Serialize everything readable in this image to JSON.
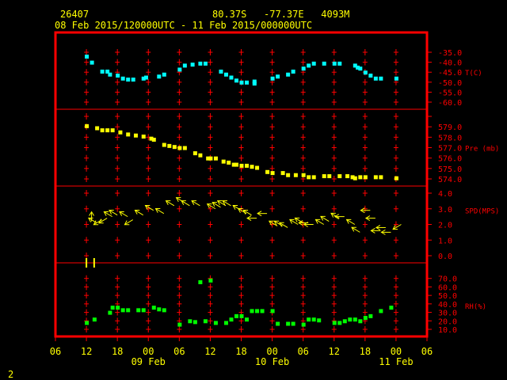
{
  "header": {
    "station": "26407",
    "location": "80.37S   -77.37E   4093M",
    "period": "08 Feb 2015/120000UTC - 11 Feb 2015/000000UTC"
  },
  "footer": {
    "page": "2"
  },
  "colors": {
    "frame": "#ff0000",
    "text": "#ffff00",
    "temp": "#00ffff",
    "pres": "#ffff00",
    "wind": "#ffff00",
    "rh": "#00ff00",
    "grid": "#ff0000"
  },
  "chart_data": {
    "type": "scatter",
    "x_axis": {
      "unit": "hour since 08 Feb 00UTC",
      "range": [
        6,
        78
      ],
      "ticks": [
        6,
        12,
        18,
        24,
        30,
        36,
        42,
        48,
        54,
        60,
        66,
        72,
        78
      ],
      "tick_labels": [
        "06",
        "12",
        "18",
        "00",
        "06",
        "12",
        "18",
        "00",
        "06",
        "12",
        "18",
        "00",
        "06"
      ],
      "date_labels": [
        {
          "x": 24,
          "label": "09 Feb"
        },
        {
          "x": 48,
          "label": "10 Feb"
        },
        {
          "x": 72,
          "label": "11 Feb"
        }
      ]
    },
    "panels": [
      {
        "id": "temp",
        "label": "T(C)",
        "range": [
          -60,
          -35
        ],
        "ticks": [
          -35,
          -40,
          -45,
          -50,
          -55,
          -60
        ],
        "tick_labels": [
          "-35.0",
          "-40.0",
          "-45.0",
          "-50.0",
          "-55.0",
          "-60.0"
        ],
        "points": [
          [
            12,
            -37
          ],
          [
            13,
            -40
          ],
          [
            15,
            -44.5
          ],
          [
            16,
            -44.5
          ],
          [
            16.5,
            -46
          ],
          [
            18,
            -46.5
          ],
          [
            19,
            -48
          ],
          [
            20,
            -48.5
          ],
          [
            21,
            -48.5
          ],
          [
            23,
            -48
          ],
          [
            23.5,
            -47.5
          ],
          [
            26,
            -47
          ],
          [
            27,
            -46
          ],
          [
            30,
            -43.5
          ],
          [
            31,
            -41.5
          ],
          [
            32.5,
            -41
          ],
          [
            34,
            -40.5
          ],
          [
            35,
            -40.5
          ],
          [
            38,
            -44.5
          ],
          [
            39,
            -46
          ],
          [
            40,
            -47.5
          ],
          [
            41,
            -49
          ],
          [
            42,
            -50
          ],
          [
            43,
            -50
          ],
          [
            44.5,
            -49.5
          ],
          [
            44.5,
            -50.5
          ],
          [
            48,
            -48
          ],
          [
            49,
            -47
          ],
          [
            51,
            -46
          ],
          [
            52,
            -44.5
          ],
          [
            54,
            -43
          ],
          [
            55,
            -41.5
          ],
          [
            56,
            -40.5
          ],
          [
            58,
            -40.5
          ],
          [
            60,
            -40.5
          ],
          [
            61,
            -40.5
          ],
          [
            64,
            -41.5
          ],
          [
            64.5,
            -42.5
          ],
          [
            65,
            -43
          ],
          [
            66,
            -45
          ],
          [
            67,
            -46.5
          ],
          [
            68,
            -48
          ],
          [
            69,
            -48
          ],
          [
            72,
            -48
          ]
        ]
      },
      {
        "id": "pres",
        "label": "Pre (mb)",
        "range": [
          574,
          580
        ],
        "ticks": [
          580,
          579,
          578,
          577,
          576,
          575,
          574
        ],
        "tick_labels": [
          "",
          "579.0",
          "578.0",
          "577.0",
          "576.0",
          "575.0",
          "574.0"
        ],
        "points": [
          [
            12,
            579.1
          ],
          [
            14,
            578.9
          ],
          [
            15,
            578.7
          ],
          [
            16,
            578.7
          ],
          [
            17,
            578.7
          ],
          [
            18.5,
            578.5
          ],
          [
            20,
            578.3
          ],
          [
            21.5,
            578.2
          ],
          [
            23,
            578.1
          ],
          [
            24.5,
            577.9
          ],
          [
            25,
            577.8
          ],
          [
            27,
            577.3
          ],
          [
            28,
            577.2
          ],
          [
            29,
            577.1
          ],
          [
            30,
            577
          ],
          [
            31,
            577
          ],
          [
            33,
            576.5
          ],
          [
            34,
            576.3
          ],
          [
            35.5,
            576
          ],
          [
            36,
            576
          ],
          [
            37,
            576
          ],
          [
            38.5,
            575.7
          ],
          [
            39.5,
            575.6
          ],
          [
            40.5,
            575.4
          ],
          [
            41,
            575.4
          ],
          [
            42,
            575.3
          ],
          [
            43,
            575.3
          ],
          [
            44,
            575.2
          ],
          [
            45,
            575.1
          ],
          [
            47,
            574.7
          ],
          [
            48,
            574.6
          ],
          [
            50,
            574.6
          ],
          [
            51,
            574.4
          ],
          [
            52.5,
            574.4
          ],
          [
            54,
            574.4
          ],
          [
            55,
            574.2
          ],
          [
            56,
            574.2
          ],
          [
            58,
            574.3
          ],
          [
            59,
            574.3
          ],
          [
            61,
            574.3
          ],
          [
            62.5,
            574.3
          ],
          [
            63.5,
            574.2
          ],
          [
            64,
            574.1
          ],
          [
            65,
            574.2
          ],
          [
            66,
            574.2
          ],
          [
            68,
            574.2
          ],
          [
            69,
            574.2
          ],
          [
            72,
            574.1
          ]
        ]
      },
      {
        "id": "wind",
        "label": "SPD(MPS)",
        "range": [
          0,
          4
        ],
        "ticks": [
          4,
          3,
          2,
          1,
          0
        ],
        "tick_labels": [
          "4.0",
          "3.0",
          "2.0",
          "1.0",
          "0.0"
        ],
        "barbs": [
          [
            13,
            2.2,
            "N"
          ],
          [
            14,
            2.1,
            "NW"
          ],
          [
            15,
            2.3,
            "SW"
          ],
          [
            16,
            2.4,
            "SW"
          ],
          [
            17,
            2.5,
            "NW"
          ],
          [
            18,
            2.6,
            "NW"
          ],
          [
            20,
            2.5,
            "NW"
          ],
          [
            21,
            2.3,
            "SW"
          ],
          [
            23,
            2.6,
            "NW"
          ],
          [
            25,
            2.9,
            "NW"
          ],
          [
            27,
            2.7,
            "NW"
          ],
          [
            29,
            3.2,
            "NW"
          ],
          [
            31,
            3.4,
            "NW"
          ],
          [
            32,
            3.2,
            "NW"
          ],
          [
            34,
            3.2,
            "NW"
          ],
          [
            37,
            3.0,
            "NW"
          ],
          [
            38,
            3.1,
            "NW"
          ],
          [
            39,
            3.2,
            "NW"
          ],
          [
            40,
            3.2,
            "NW"
          ],
          [
            42,
            2.9,
            "NW"
          ],
          [
            43,
            2.7,
            "NW"
          ],
          [
            44,
            2.6,
            "NW"
          ],
          [
            45,
            2.4,
            "W"
          ],
          [
            47,
            2.7,
            "W"
          ],
          [
            49,
            1.9,
            "NW"
          ],
          [
            50,
            1.9,
            "NW"
          ],
          [
            51,
            1.8,
            "NW"
          ],
          [
            53,
            2.0,
            "NW"
          ],
          [
            54,
            2.1,
            "NW"
          ],
          [
            55,
            2.1,
            "W"
          ],
          [
            56,
            2.0,
            "W"
          ],
          [
            58,
            2.0,
            "NW"
          ],
          [
            59,
            2.2,
            "NW"
          ],
          [
            61,
            2.4,
            "NW"
          ],
          [
            62,
            2.5,
            "W"
          ],
          [
            64,
            2.0,
            "NW"
          ],
          [
            65,
            1.5,
            "NW"
          ],
          [
            67,
            2.9,
            "W"
          ],
          [
            68,
            2.4,
            "W"
          ],
          [
            69,
            1.6,
            "W"
          ],
          [
            70,
            1.8,
            "W"
          ],
          [
            71,
            1.5,
            "W"
          ],
          [
            73,
            2.0,
            "SW"
          ]
        ]
      },
      {
        "id": "rh",
        "label": "RH(%)",
        "range": [
          10,
          80
        ],
        "ticks": [
          70,
          60,
          50,
          40,
          30,
          20,
          10
        ],
        "tick_labels": [
          "70.0",
          "60.0",
          "50.0",
          "40.0",
          "30.0",
          "20.0",
          "10.0"
        ],
        "points": [
          [
            12,
            18
          ],
          [
            13.5,
            22
          ],
          [
            16.5,
            30
          ],
          [
            17,
            36
          ],
          [
            18,
            36
          ],
          [
            19,
            33
          ],
          [
            20,
            33
          ],
          [
            22,
            33
          ],
          [
            23,
            33
          ],
          [
            25,
            36
          ],
          [
            26,
            34
          ],
          [
            27,
            33
          ],
          [
            30,
            16
          ],
          [
            32,
            20
          ],
          [
            33,
            19
          ],
          [
            34,
            66
          ],
          [
            35,
            20
          ],
          [
            36,
            68
          ],
          [
            37,
            18
          ],
          [
            39,
            18
          ],
          [
            40,
            22
          ],
          [
            41,
            26
          ],
          [
            42,
            26
          ],
          [
            43,
            22
          ],
          [
            44,
            32
          ],
          [
            45,
            32
          ],
          [
            46,
            32
          ],
          [
            48,
            32
          ],
          [
            49,
            17
          ],
          [
            51,
            17
          ],
          [
            52,
            17
          ],
          [
            54,
            16
          ],
          [
            55,
            22
          ],
          [
            56,
            22
          ],
          [
            57,
            21
          ],
          [
            60,
            18
          ],
          [
            61,
            18
          ],
          [
            62,
            20
          ],
          [
            63,
            22
          ],
          [
            64,
            22
          ],
          [
            65,
            20
          ],
          [
            66,
            24
          ],
          [
            67,
            26
          ],
          [
            69,
            32
          ],
          [
            71,
            36
          ]
        ]
      }
    ],
    "qc_marks_top_of_rh": [
      {
        "x": 12
      },
      {
        "x": 13.5
      }
    ]
  }
}
